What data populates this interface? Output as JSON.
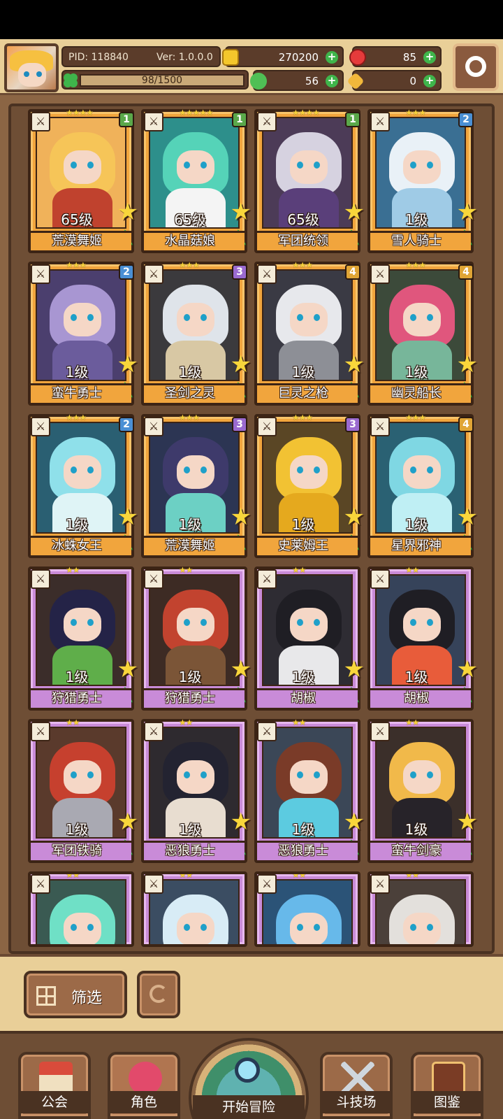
{
  "header": {
    "pid": "PID: 118840",
    "version": "Ver: 1.0.0.0",
    "exp": "98/1500",
    "gold": "270200",
    "gems": "85",
    "clover": "56",
    "keys": "0"
  },
  "cards": [
    {
      "name": "荒漠舞姬",
      "level": "65级",
      "stars": "★★★★",
      "badge": "1",
      "frame": "gold",
      "colors": [
        "#f0b25a",
        "#f6c558",
        "#c0422e",
        "#6e3d2a"
      ]
    },
    {
      "name": "水晶菇娘",
      "level": "65级",
      "stars": "★★★★★",
      "badge": "1",
      "frame": "gold",
      "colors": [
        "#2d8f8b",
        "#55d3b8",
        "#f4f4f4",
        "#2c6f86"
      ]
    },
    {
      "name": "军团统领",
      "level": "65级",
      "stars": "★★★★",
      "badge": "1",
      "frame": "gold",
      "colors": [
        "#4c3b57",
        "#d6d2e0",
        "#5a3f7a",
        "#3a2a45"
      ]
    },
    {
      "name": "雪人骑士",
      "level": "1级",
      "stars": "★★★",
      "badge": "2",
      "frame": "gold",
      "colors": [
        "#3a6f93",
        "#e9f1f7",
        "#9fcbe6",
        "#2f5677"
      ]
    },
    {
      "name": "蛮牛勇士",
      "level": "1级",
      "stars": "★★★",
      "badge": "2",
      "frame": "gold",
      "colors": [
        "#4b3f6e",
        "#a896d2",
        "#6b5c9c",
        "#3b2f57"
      ]
    },
    {
      "name": "圣剑之灵",
      "level": "1级",
      "stars": "★★★",
      "badge": "3",
      "frame": "gold",
      "colors": [
        "#3b3a3d",
        "#dfe4ea",
        "#d8c8a4",
        "#2d2a26"
      ]
    },
    {
      "name": "巨灵之枪",
      "level": "1级",
      "stars": "★★★",
      "badge": "4",
      "frame": "gold",
      "colors": [
        "#3a3a44",
        "#e7e8ec",
        "#8d8f96",
        "#2b2b33"
      ]
    },
    {
      "name": "幽灵船长",
      "level": "1级",
      "stars": "★★★",
      "badge": "4",
      "frame": "gold",
      "colors": [
        "#3c4a3a",
        "#e0567d",
        "#77b69a",
        "#2f3b2d"
      ]
    },
    {
      "name": "冰蛛女王",
      "level": "1级",
      "stars": "★★★",
      "badge": "2",
      "frame": "gold",
      "colors": [
        "#2a5f72",
        "#8fe0ea",
        "#dff4f6",
        "#21495a"
      ]
    },
    {
      "name": "荒漠舞姬",
      "level": "1级",
      "stars": "★★★",
      "badge": "3",
      "frame": "gold",
      "colors": [
        "#2c3553",
        "#3e3a6b",
        "#6cd0c4",
        "#1e2540"
      ]
    },
    {
      "name": "史莱姆王",
      "level": "1级",
      "stars": "★★★",
      "badge": "3",
      "frame": "gold",
      "colors": [
        "#5a4625",
        "#f2c233",
        "#e5a91e",
        "#4a3920"
      ]
    },
    {
      "name": "星界邪神",
      "level": "1级",
      "stars": "★★★",
      "badge": "4",
      "frame": "gold",
      "colors": [
        "#2a6173",
        "#7fd7e3",
        "#bfeff4",
        "#234f5d"
      ]
    },
    {
      "name": "狩猎勇士",
      "level": "1级",
      "stars": "★★",
      "badge": "",
      "frame": "purple",
      "colors": [
        "#3b2d2a",
        "#242347",
        "#5fae4a",
        "#6e4b2e"
      ]
    },
    {
      "name": "狩猎勇士",
      "level": "1级",
      "stars": "★★",
      "badge": "",
      "frame": "purple",
      "colors": [
        "#3d2b24",
        "#c2432f",
        "#7b5537",
        "#2d2a25"
      ]
    },
    {
      "name": "胡椒",
      "level": "1级",
      "stars": "★★",
      "badge": "",
      "frame": "purple",
      "colors": [
        "#2e2c33",
        "#1f1e24",
        "#e8e8ea",
        "#4a4a55"
      ]
    },
    {
      "name": "胡椒",
      "level": "1级",
      "stars": "★★",
      "badge": "",
      "frame": "purple",
      "colors": [
        "#36435a",
        "#1f1e24",
        "#e85c3a",
        "#3a3a4a"
      ]
    },
    {
      "name": "军团铁骑",
      "level": "1级",
      "stars": "★★",
      "badge": "",
      "frame": "purple",
      "colors": [
        "#5a3a2c",
        "#c6402e",
        "#a9a9b2",
        "#6c4428"
      ]
    },
    {
      "name": "恶狼勇士",
      "level": "1级",
      "stars": "★★",
      "badge": "",
      "frame": "purple",
      "colors": [
        "#2e2a2f",
        "#232331",
        "#e8ddd0",
        "#3b3442"
      ]
    },
    {
      "name": "恶狼勇士",
      "level": "1级",
      "stars": "★★",
      "badge": "",
      "frame": "purple",
      "colors": [
        "#3b4757",
        "#7a3b28",
        "#5ccbe0",
        "#2f2520"
      ]
    },
    {
      "name": "蛮牛剑豪",
      "level": "1级",
      "stars": "★★",
      "badge": "",
      "frame": "purple",
      "colors": [
        "#3b2f2a",
        "#f1b94a",
        "#272329",
        "#4a3a30"
      ]
    },
    {
      "name": "",
      "level": "",
      "stars": "★★",
      "badge": "",
      "frame": "purple",
      "colors": [
        "#3a5a52",
        "#6fe0c6",
        "#c6f2e6",
        "#2f4a44"
      ]
    },
    {
      "name": "",
      "level": "",
      "stars": "★★",
      "badge": "",
      "frame": "purple",
      "colors": [
        "#3b4d62",
        "#d8ecf6",
        "#9fc7dc",
        "#2f3e50"
      ]
    },
    {
      "name": "",
      "level": "",
      "stars": "★★",
      "badge": "",
      "frame": "purple",
      "colors": [
        "#2b5377",
        "#67b9ea",
        "#9bd6f5",
        "#234562"
      ]
    },
    {
      "name": "",
      "level": "",
      "stars": "★★",
      "badge": "",
      "frame": "purple",
      "colors": [
        "#4b403a",
        "#e3e0dc",
        "#c6bfb6",
        "#3a312c"
      ]
    }
  ],
  "filter": {
    "label": "筛选"
  },
  "nav": {
    "guild": "公会",
    "role": "角色",
    "adventure": "开始冒险",
    "arena": "斗技场",
    "codex": "图鉴"
  }
}
